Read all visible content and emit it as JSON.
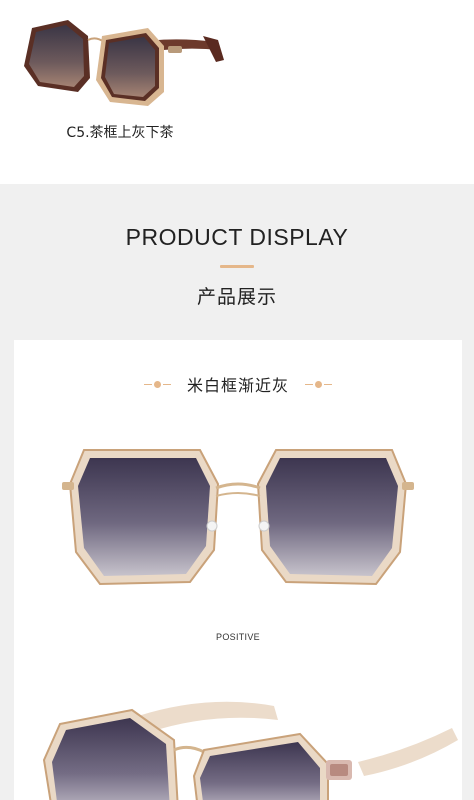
{
  "top_variant": {
    "caption": "C5.茶框上灰下茶"
  },
  "display": {
    "title": "PRODUCT DISPLAY",
    "subtitle": "产品展示",
    "color_name": "米白框渐近灰",
    "view_label": "POSITIVE"
  },
  "colors": {
    "accent": "#e5b78a",
    "section_bg": "#f0f0f0",
    "card_bg": "#ffffff"
  },
  "icons": [
    "sunglasses-product-photo",
    "decorative-dot-icon"
  ]
}
